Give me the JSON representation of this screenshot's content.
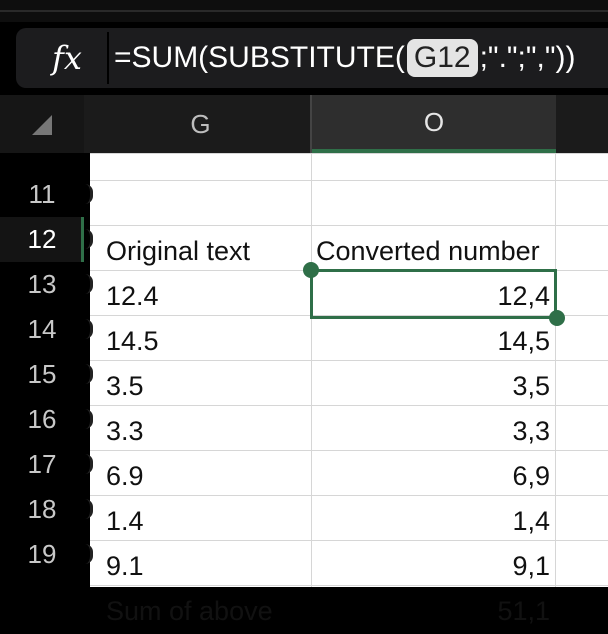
{
  "formula_bar": {
    "fx_label": "fx",
    "formula_prefix": "=SUM(SUBSTITUTE(",
    "formula_ref": "G12",
    "formula_suffix": ";\".\";\",\"))"
  },
  "columns": [
    {
      "label": "G",
      "selected": false
    },
    {
      "label": "O",
      "selected": true
    }
  ],
  "rows": [
    {
      "num": "11",
      "g": "Original text",
      "o": "Converted number"
    },
    {
      "num": "12",
      "g": "12.4",
      "o": "12,4"
    },
    {
      "num": "13",
      "g": "14.5",
      "o": "14,5"
    },
    {
      "num": "14",
      "g": "3.5",
      "o": "3,5"
    },
    {
      "num": "15",
      "g": "3.3",
      "o": "3,3"
    },
    {
      "num": "16",
      "g": "6.9",
      "o": "6,9"
    },
    {
      "num": "17",
      "g": "1.4",
      "o": "1,4"
    },
    {
      "num": "18",
      "g": "9.1",
      "o": "9,1"
    },
    {
      "num": "19",
      "g": "Sum of above",
      "o": "51,1"
    }
  ],
  "selected_cell": "O12",
  "colors": {
    "selection": "#2f6f48",
    "sheet_bg": "#ffffff",
    "chrome_bg": "#1c1c1e"
  }
}
